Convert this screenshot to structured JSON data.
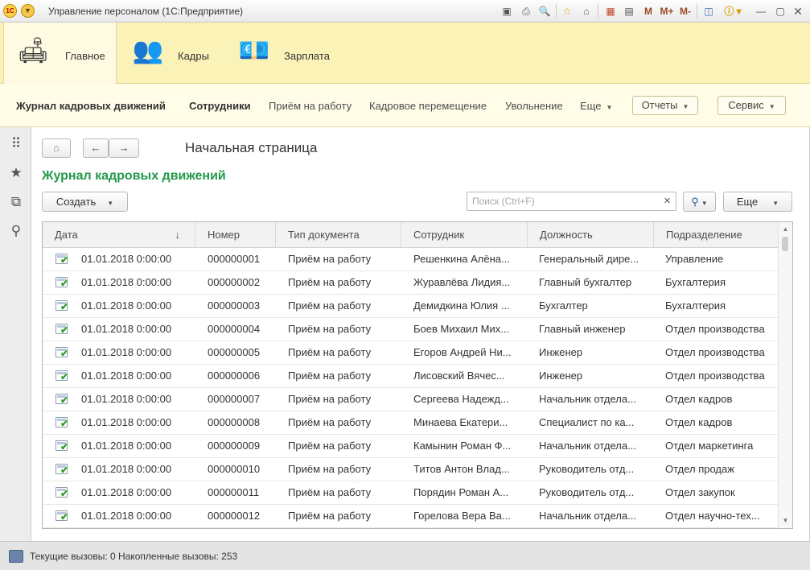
{
  "window": {
    "title": "Управление персоналом  (1С:Предприятие)",
    "logo_text": "1С",
    "toolbar_icons": [
      "save-icon",
      "print-icon",
      "preview-icon",
      "favorites-add-icon",
      "history-icon",
      "calendar-icon",
      "calculator-icon",
      "memory-m-icon",
      "memory-plus-icon",
      "memory-minus-icon",
      "panel-layout-icon",
      "info-icon",
      "minimize-icon",
      "maximize-icon",
      "close-icon"
    ],
    "memory_labels": [
      "M",
      "M+",
      "M-"
    ]
  },
  "sections": [
    {
      "label": "Главное",
      "icon": "desk-lamp-icon",
      "active": true
    },
    {
      "label": "Кадры",
      "icon": "people-icon",
      "active": false
    },
    {
      "label": "Зарплата",
      "icon": "money-icon",
      "active": false
    }
  ],
  "navbar": {
    "links": [
      "Журнал кадровых движений",
      "Сотрудники",
      "Приём на работу",
      "Кадровое перемещение",
      "Увольнение",
      "Еще"
    ],
    "reports_label": "Отчеты",
    "service_label": "Сервис"
  },
  "side_panel": [
    "apps-grid-icon",
    "star-icon",
    "history-icon",
    "search-icon"
  ],
  "workspace": {
    "page_title": "Начальная страница",
    "form_title": "Журнал кадровых движений",
    "create_label": "Создать",
    "search_placeholder": "Поиск (Ctrl+F)",
    "more_label": "Еще"
  },
  "table": {
    "columns": [
      "Дата",
      "Номер",
      "Тип документа",
      "Сотрудник",
      "Должность",
      "Подразделение"
    ],
    "rows": [
      {
        "date": "01.01.2018 0:00:00",
        "number": "000000001",
        "type": "Приём на работу",
        "employee": "Решенкина Алёна...",
        "position": "Генеральный дире...",
        "department": "Управление"
      },
      {
        "date": "01.01.2018 0:00:00",
        "number": "000000002",
        "type": "Приём на работу",
        "employee": "Журавлёва Лидия...",
        "position": "Главный бухгалтер",
        "department": "Бухгалтерия"
      },
      {
        "date": "01.01.2018 0:00:00",
        "number": "000000003",
        "type": "Приём на работу",
        "employee": "Демидкина Юлия ...",
        "position": "Бухгалтер",
        "department": "Бухгалтерия"
      },
      {
        "date": "01.01.2018 0:00:00",
        "number": "000000004",
        "type": "Приём на работу",
        "employee": "Боев Михаил Мих...",
        "position": "Главный инженер",
        "department": "Отдел производства"
      },
      {
        "date": "01.01.2018 0:00:00",
        "number": "000000005",
        "type": "Приём на работу",
        "employee": "Егоров Андрей Ни...",
        "position": "Инженер",
        "department": "Отдел производства"
      },
      {
        "date": "01.01.2018 0:00:00",
        "number": "000000006",
        "type": "Приём на работу",
        "employee": "Лисовский Вячес...",
        "position": "Инженер",
        "department": "Отдел производства"
      },
      {
        "date": "01.01.2018 0:00:00",
        "number": "000000007",
        "type": "Приём на работу",
        "employee": "Сергеева Надежд...",
        "position": "Начальник отдела...",
        "department": "Отдел кадров"
      },
      {
        "date": "01.01.2018 0:00:00",
        "number": "000000008",
        "type": "Приём на работу",
        "employee": "Минаева Екатери...",
        "position": "Специалист по ка...",
        "department": "Отдел кадров"
      },
      {
        "date": "01.01.2018 0:00:00",
        "number": "000000009",
        "type": "Приём на работу",
        "employee": "Камынин Роман Ф...",
        "position": "Начальник отдела...",
        "department": "Отдел маркетинга"
      },
      {
        "date": "01.01.2018 0:00:00",
        "number": "000000010",
        "type": "Приём на работу",
        "employee": "Титов Антон Влад...",
        "position": "Руководитель отд...",
        "department": "Отдел продаж"
      },
      {
        "date": "01.01.2018 0:00:00",
        "number": "000000011",
        "type": "Приём на работу",
        "employee": "Порядин Роман А...",
        "position": "Руководитель отд...",
        "department": "Отдел закупок"
      },
      {
        "date": "01.01.2018 0:00:00",
        "number": "000000012",
        "type": "Приём на работу",
        "employee": "Горелова Вера Ва...",
        "position": "Начальник отдела...",
        "department": "Отдел научно-тех..."
      }
    ]
  },
  "statusbar": {
    "text": "Текущие вызовы: 0   Накопленные вызовы: 253"
  }
}
